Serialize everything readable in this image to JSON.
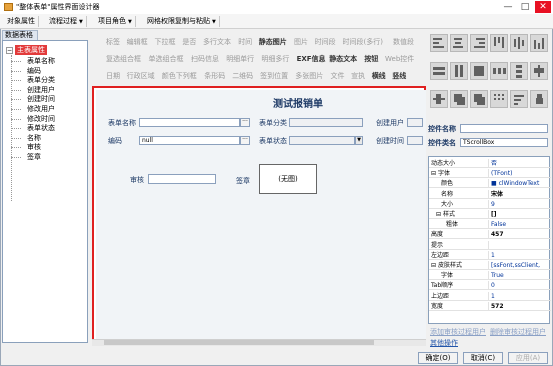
{
  "window": {
    "title": "\"整体表单\"属性界面设计器",
    "minimize": "—",
    "maximize": "□",
    "close": "✕"
  },
  "menubar": {
    "items": [
      {
        "label": "对象属性",
        "has_arrow": false
      },
      {
        "label": "流程过程",
        "has_arrow": true
      },
      {
        "label": "项目角色",
        "has_arrow": true
      },
      {
        "label": "网格权限复制与粘贴",
        "has_arrow": true
      }
    ],
    "arrow": "▼"
  },
  "left_panel": {
    "tab": "数据表格",
    "root": "主表属性",
    "toggle": "−",
    "items": [
      "表单名称",
      "编码",
      "表单分类",
      "创建用户",
      "创建时间",
      "修改用户",
      "修改时间",
      "表单状态",
      "名称",
      "审核",
      "签章"
    ]
  },
  "toolbar": {
    "rows": [
      [
        {
          "label": "标签",
          "style": "dim"
        },
        {
          "label": "编辑框",
          "style": "dim"
        },
        {
          "label": "下拉框",
          "style": "dim"
        },
        {
          "label": "是否",
          "style": "dim"
        },
        {
          "label": "多行文本",
          "style": "dim"
        },
        {
          "label": "时间",
          "style": "dim"
        },
        {
          "label": "静态图片",
          "style": "bold"
        },
        {
          "label": "图片",
          "style": "dim"
        },
        {
          "label": "时间段",
          "style": "dim"
        },
        {
          "label": "时间段(多行)",
          "style": "dim"
        },
        {
          "label": "数值段",
          "style": "dim"
        }
      ],
      [
        {
          "label": "复选组合框",
          "style": "dim"
        },
        {
          "label": "单选组合框",
          "style": "dim"
        },
        {
          "label": "扫码信息",
          "style": "dim"
        },
        {
          "label": "明细单行",
          "style": "dim"
        },
        {
          "label": "明细多行",
          "style": "dim"
        },
        {
          "label": "EXF信息",
          "style": "bold"
        },
        {
          "label": "静态文本",
          "style": "bold"
        },
        {
          "label": "按钮",
          "style": "bold"
        },
        {
          "label": "Web控件",
          "style": "dim"
        }
      ],
      [
        {
          "label": "日期",
          "style": "dim"
        },
        {
          "label": "行政区域",
          "style": "dim"
        },
        {
          "label": "颜色下列框",
          "style": "dim"
        },
        {
          "label": "条形码",
          "style": "dim"
        },
        {
          "label": "二维码",
          "style": "dim"
        },
        {
          "label": "签到位置",
          "style": "dim"
        },
        {
          "label": "多张图片",
          "style": "dim"
        },
        {
          "label": "文件",
          "style": "dim"
        },
        {
          "label": "宣执",
          "style": "dim"
        },
        {
          "label": "横线",
          "style": "bold"
        },
        {
          "label": "竖线",
          "style": "bold"
        }
      ]
    ]
  },
  "icon_palette": {
    "items": [
      "align-left-icon",
      "align-center-icon",
      "align-right-icon",
      "align-top-icon",
      "align-middle-icon",
      "align-bottom-icon",
      "same-width-icon",
      "same-height-icon",
      "same-size-icon",
      "space-horizontal-icon",
      "space-vertical-icon",
      "center-horizontal-icon",
      "center-vertical-icon",
      "bring-front-icon",
      "send-back-icon",
      "grid-snap-icon",
      "tab-order-icon",
      "lock-icon"
    ]
  },
  "form": {
    "title": "测试报销单",
    "fields": {
      "form_name_label": "表单名称",
      "form_name_value": "",
      "form_category_label": "表单分类",
      "form_category_value": "",
      "created_by_label": "创建用户",
      "created_by_value": "",
      "code_label": "编码",
      "code_value": "null",
      "form_status_label": "表单状态",
      "form_status_value": "",
      "created_time_label": "创建时间",
      "created_time_value": "",
      "review_label": "审核",
      "review_value": "",
      "seal_label": "签章",
      "seal_image_text": "(无图)"
    },
    "ellipsis": "···",
    "combo_arrow": "▼"
  },
  "properties": {
    "control_name_label": "控件名称",
    "control_name_value": "",
    "control_class_label": "控件类名",
    "control_class_value": "TScrollBox",
    "rows": [
      {
        "name": "动态大小",
        "value": "否",
        "indent": 0
      },
      {
        "name": "字体",
        "value": "(TFont)",
        "indent": 0,
        "toggle": "⊟"
      },
      {
        "name": "颜色",
        "value": "■ clWindowText",
        "indent": 2
      },
      {
        "name": "名称",
        "value": "宋体",
        "indent": 2,
        "bold": true
      },
      {
        "name": "大小",
        "value": "9",
        "indent": 2
      },
      {
        "name": "样式",
        "value": "[]",
        "indent": 1,
        "toggle": "⊟",
        "bold": true
      },
      {
        "name": "粗体",
        "value": "False",
        "indent": 3
      },
      {
        "name": "高度",
        "value": "457",
        "indent": 0,
        "bold": true
      },
      {
        "name": "提示",
        "value": "",
        "indent": 0
      },
      {
        "name": "左边距",
        "value": "1",
        "indent": 0
      },
      {
        "name": "皮肤样式",
        "value": "[ssFont,ssClient,",
        "indent": 0,
        "toggle": "⊟"
      },
      {
        "name": "字体",
        "value": "True",
        "indent": 2
      },
      {
        "name": "Tab顺序",
        "value": "0",
        "indent": 0
      },
      {
        "name": "上边距",
        "value": "1",
        "indent": 0
      },
      {
        "name": "宽度",
        "value": "572",
        "indent": 0,
        "bold": true
      }
    ],
    "link_add_user": "添加审核过程用户",
    "link_delete_user": "删除审核过程用户",
    "other_ops": "其他操作"
  },
  "footer": {
    "ok": "确定(O)",
    "cancel": "取消(C)",
    "apply": "应用(A)"
  }
}
